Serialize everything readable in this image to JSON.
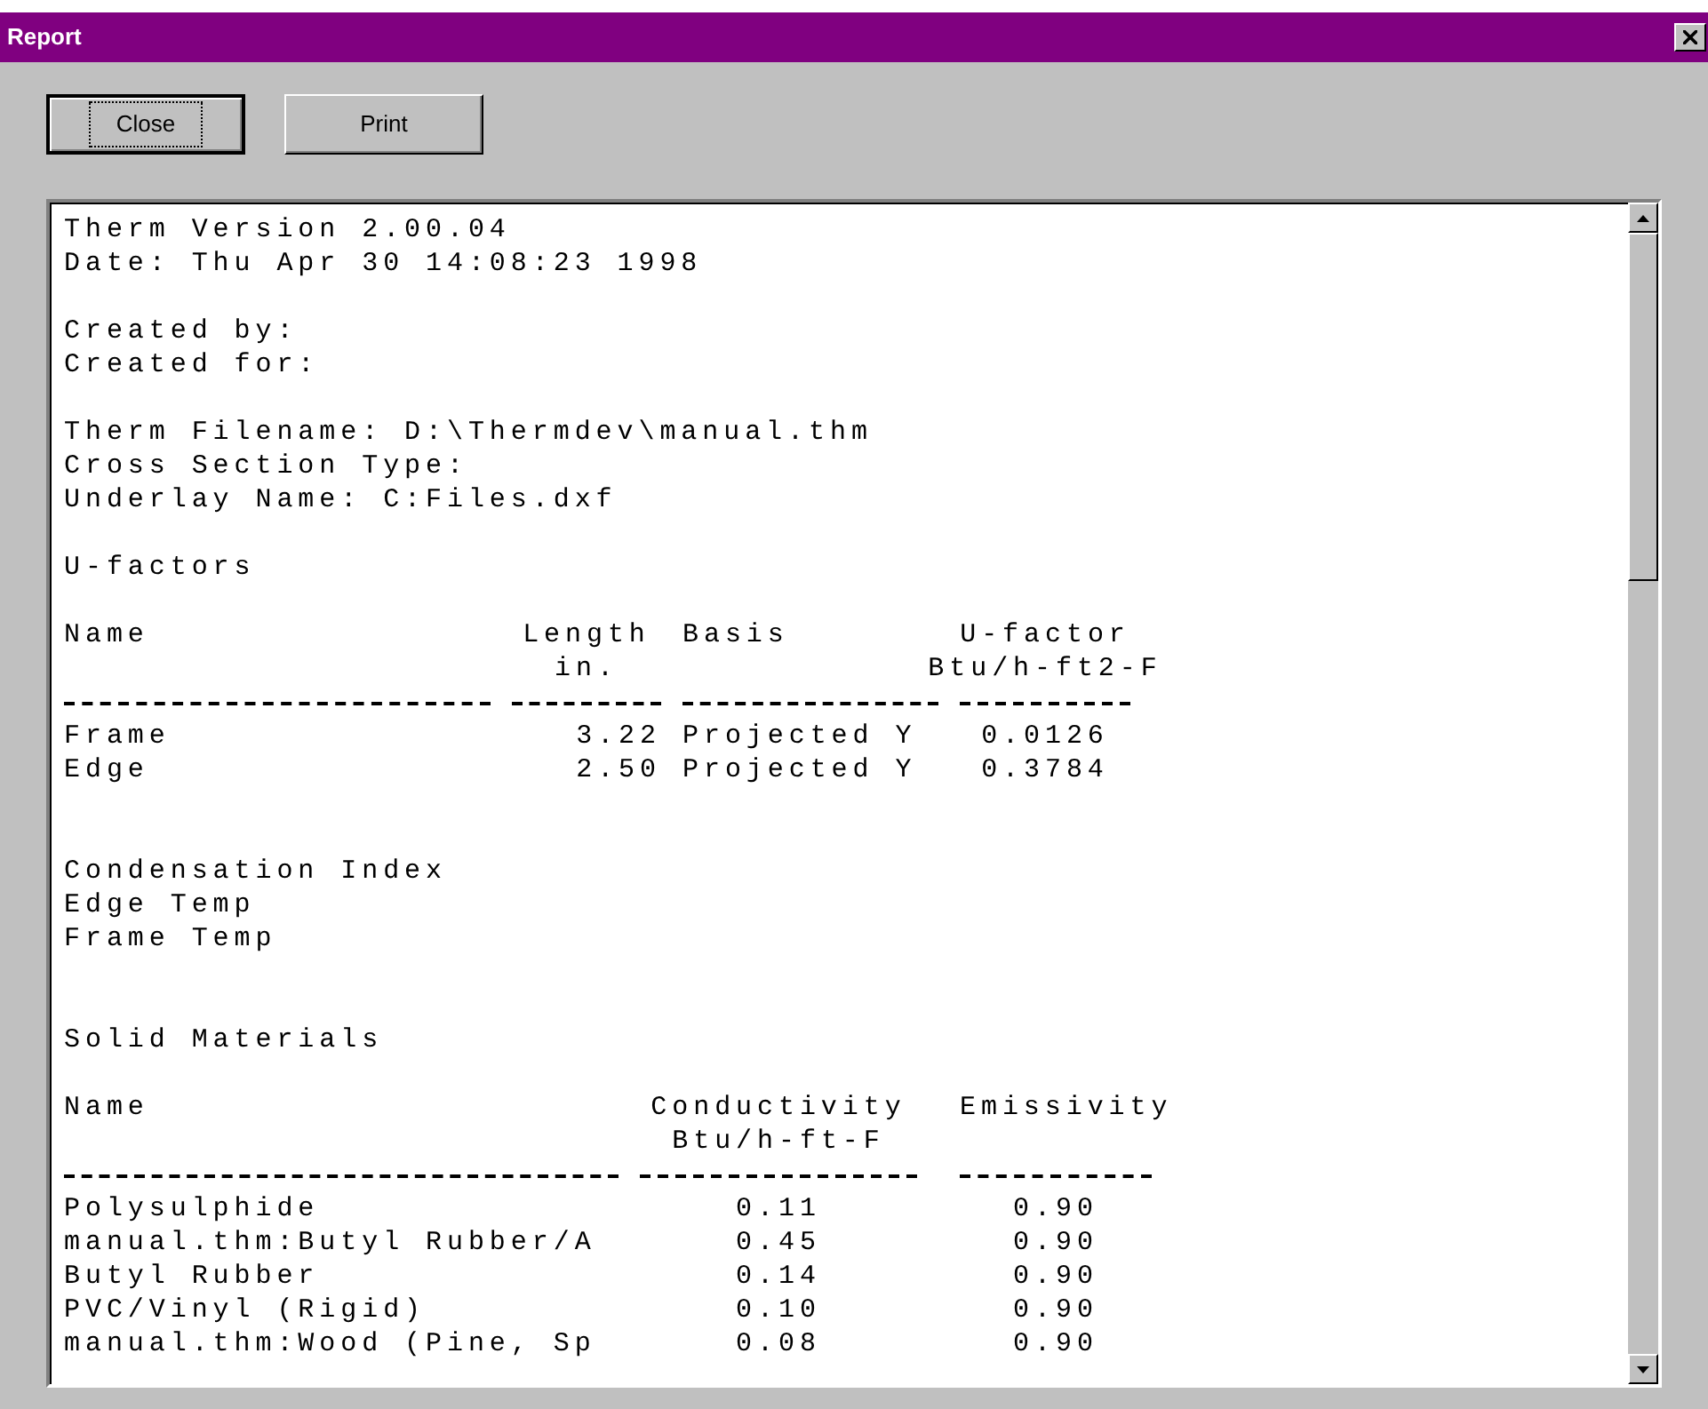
{
  "window": {
    "title": "Report"
  },
  "buttons": [
    {
      "label": "Close",
      "focused": true
    },
    {
      "label": "Print",
      "focused": false
    }
  ],
  "report": {
    "blocks": [
      {
        "kind": "lines",
        "extra_space_before": false,
        "lines": [
          "Therm Version 2.00.04",
          "Date: Thu Apr 30 14:08:23 1998"
        ]
      },
      {
        "kind": "lines",
        "extra_space_before": false,
        "lines": [
          "Created by:",
          "Created for:"
        ]
      },
      {
        "kind": "lines",
        "extra_space_before": false,
        "lines": [
          "Therm Filename: D:\\Thermdev\\manual.thm",
          "Cross Section Type:",
          "Underlay Name: C:Files.dxf"
        ]
      },
      {
        "kind": "lines",
        "extra_space_before": false,
        "lines": [
          "U-factors"
        ]
      },
      {
        "kind": "table",
        "extra_space_before": false,
        "columns": [
          {
            "label": "Name"
          },
          {
            "label": "Length",
            "unit": "in."
          },
          {
            "label": "Basis"
          },
          {
            "label": "U-factor",
            "unit": "Btu/h-ft2-F"
          }
        ],
        "rows": [
          [
            "Frame",
            "3.22",
            "Projected Y",
            "0.0126"
          ],
          [
            "Edge",
            "2.50",
            "Projected Y",
            "0.3784"
          ]
        ]
      },
      {
        "kind": "lines",
        "extra_space_before": true,
        "lines": [
          "Condensation Index",
          "Edge Temp",
          "Frame Temp"
        ]
      },
      {
        "kind": "lines",
        "extra_space_before": true,
        "lines": [
          "Solid Materials"
        ]
      },
      {
        "kind": "table",
        "extra_space_before": false,
        "columns": [
          {
            "label": "Name"
          },
          {
            "label": "Conductivity",
            "unit": "Btu/h-ft-F"
          },
          {
            "label": "Emissivity"
          }
        ],
        "rows": [
          [
            "Polysulphide",
            "0.11",
            "0.90"
          ],
          [
            "manual.thm:Butyl Rubber/A",
            "0.45",
            "0.90"
          ],
          [
            "Butyl Rubber",
            "0.14",
            "0.90"
          ],
          [
            "PVC/Vinyl (Rigid)",
            "0.10",
            "0.90"
          ],
          [
            "manual.thm:Wood (Pine, Sp",
            "0.08",
            "0.90"
          ]
        ]
      }
    ]
  }
}
